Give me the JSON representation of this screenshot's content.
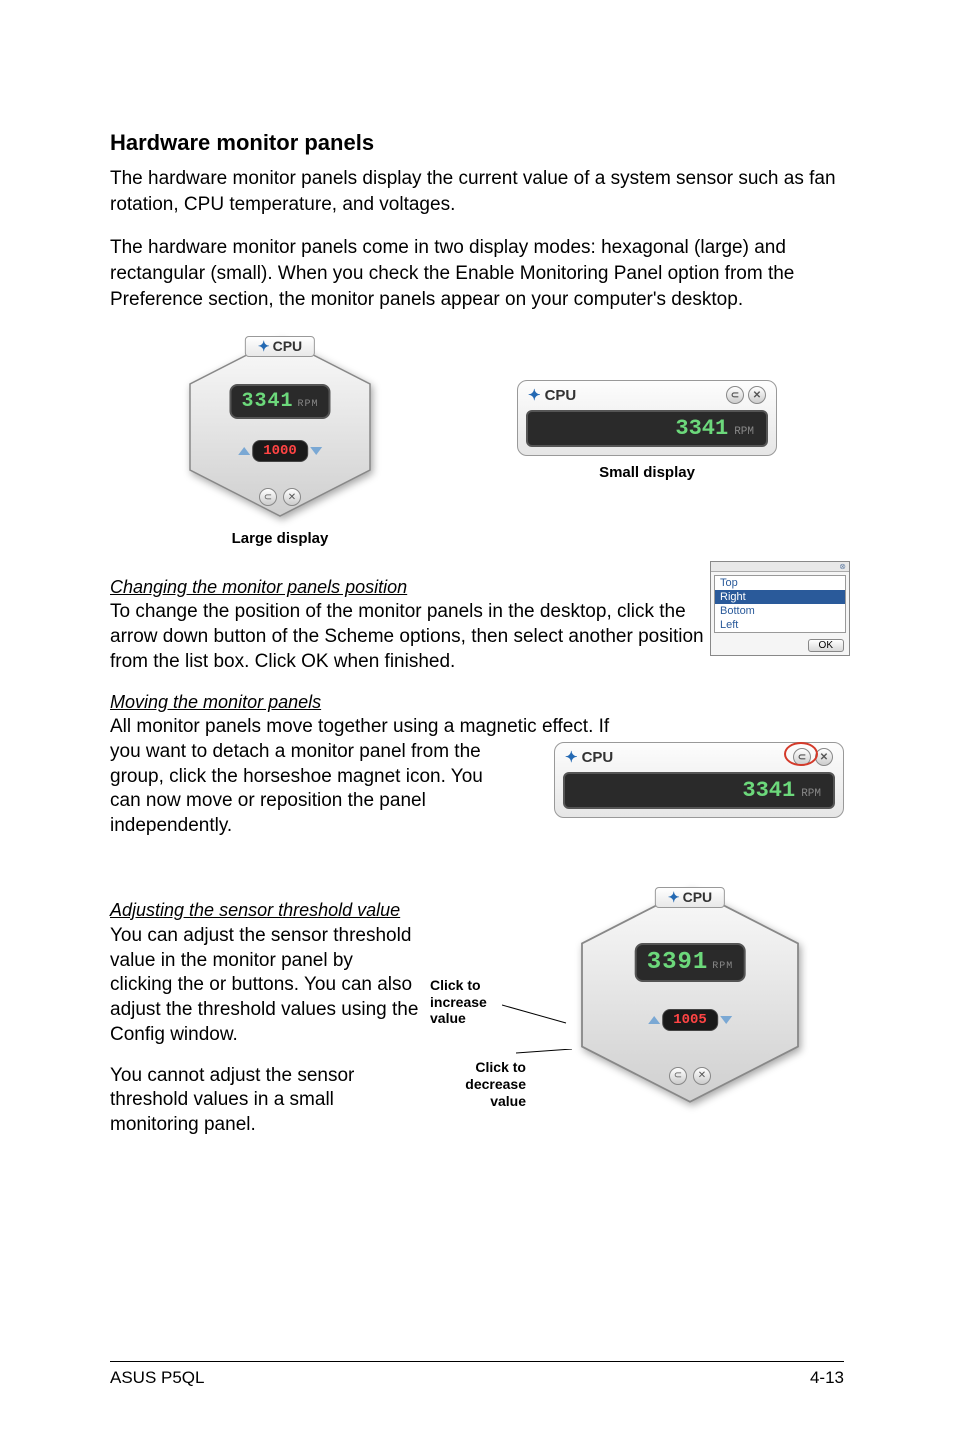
{
  "heading": "Hardware monitor panels",
  "para1": "The hardware monitor panels display the current value of a system sensor such as fan rotation, CPU temperature, and voltages.",
  "para2": "The hardware monitor panels come in two display modes: hexagonal (large) and rectangular (small). When you check the Enable Monitoring Panel option from the Preference section, the monitor panels appear on your computer's desktop.",
  "gauge": {
    "cpu_label": "CPU",
    "large_value": "3341",
    "large_unit": "RPM",
    "large_threshold": "1000",
    "small_value": "3341",
    "small_unit": "RPM",
    "move_value": "3341",
    "move_unit": "RPM",
    "adjust_value": "3391",
    "adjust_unit": "RPM",
    "adjust_threshold": "1005"
  },
  "caption_large": "Large display",
  "caption_small": "Small display",
  "section_changing": {
    "title": "Changing the monitor panels position",
    "text": "To change the position of the monitor panels in the desktop, click the arrow down button of the Scheme options, then select another position from the list box. Click OK when finished.",
    "options": [
      "Top",
      "Right",
      "Bottom",
      "Left"
    ],
    "ok": "OK"
  },
  "section_moving": {
    "title": "Moving the monitor panels",
    "line1": "All monitor panels move together using a magnetic effect. If",
    "line2": "you want to detach a monitor panel from the group, click the horseshoe magnet icon. You can now move or reposition the panel independently."
  },
  "section_adjust": {
    "title": "Adjusting the sensor threshold value",
    "text1": "You can adjust the sensor threshold value in the monitor panel by clicking the  or  buttons. You can also adjust the threshold values using the Config window.",
    "text2": "You cannot adjust the sensor threshold values in a small monitoring panel.",
    "label_inc": "Click to increase value",
    "label_dec": "Click to decrease value"
  },
  "footer": {
    "left": "ASUS P5QL",
    "right": "4-13"
  }
}
